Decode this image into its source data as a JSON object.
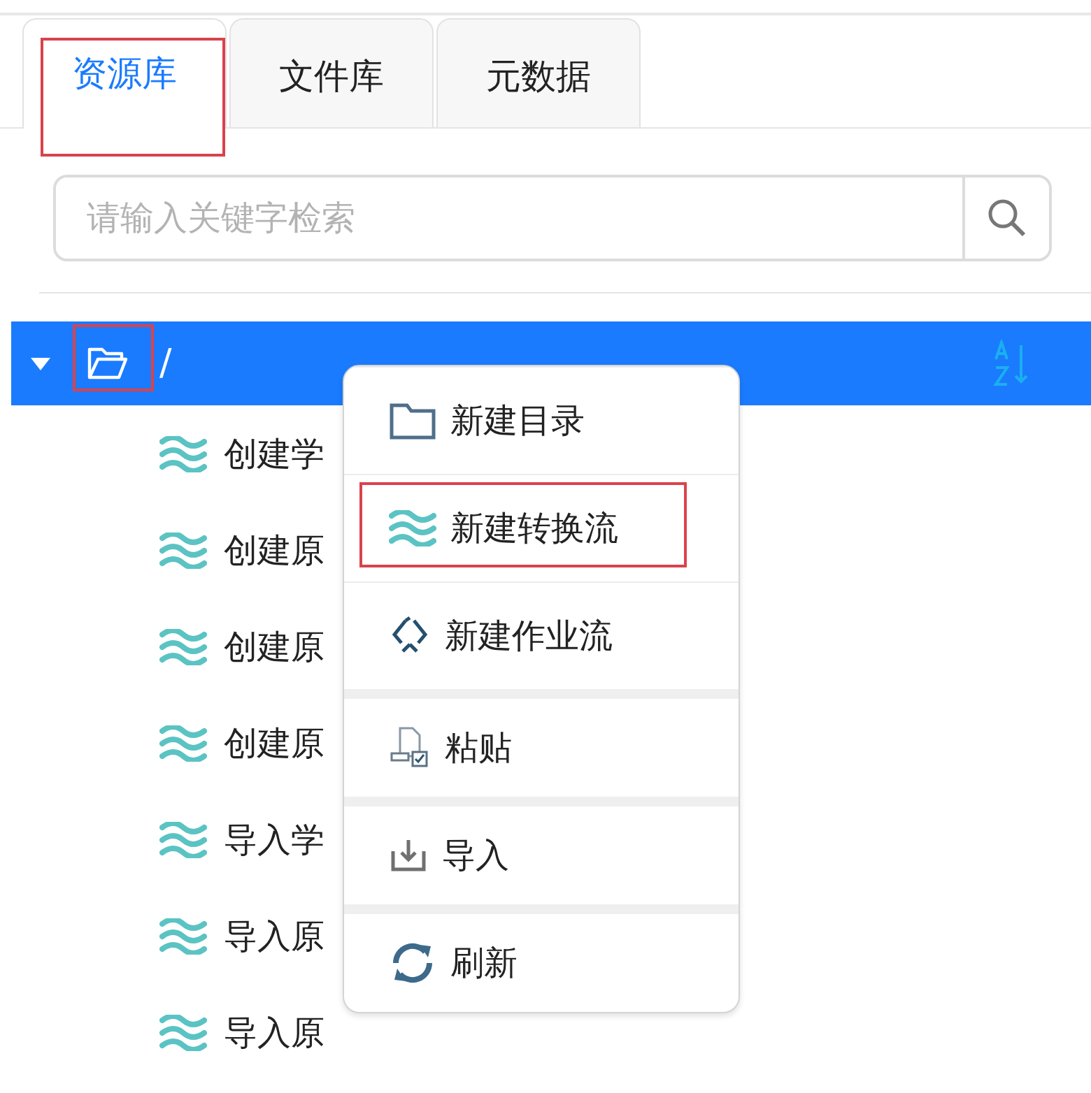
{
  "tabs": [
    {
      "label": "资源库",
      "selected": true,
      "highlighted": true
    },
    {
      "label": "文件库",
      "selected": false,
      "highlighted": false
    },
    {
      "label": "元数据",
      "selected": false,
      "highlighted": false
    }
  ],
  "search": {
    "placeholder": "请输入关键字检索"
  },
  "tree": {
    "root": {
      "label": "/",
      "expanded": true,
      "selected": true,
      "icon_highlighted": true
    },
    "children": [
      {
        "label": "创建学"
      },
      {
        "label": "创建原"
      },
      {
        "label": "创建原"
      },
      {
        "label": "创建原"
      },
      {
        "label": "导入学"
      },
      {
        "label": "导入原"
      },
      {
        "label": "导入原"
      }
    ]
  },
  "context_menu": [
    {
      "kind": "folder",
      "label": "新建目录",
      "highlighted": false,
      "group_break": false
    },
    {
      "kind": "flow",
      "label": "新建转换流",
      "highlighted": true,
      "group_break": false
    },
    {
      "kind": "job",
      "label": "新建作业流",
      "highlighted": false,
      "group_break": false
    },
    {
      "kind": "paste",
      "label": "粘贴",
      "highlighted": false,
      "group_break": true
    },
    {
      "kind": "import",
      "label": "导入",
      "highlighted": false,
      "group_break": true
    },
    {
      "kind": "refresh",
      "label": "刷新",
      "highlighted": false,
      "group_break": true
    }
  ]
}
